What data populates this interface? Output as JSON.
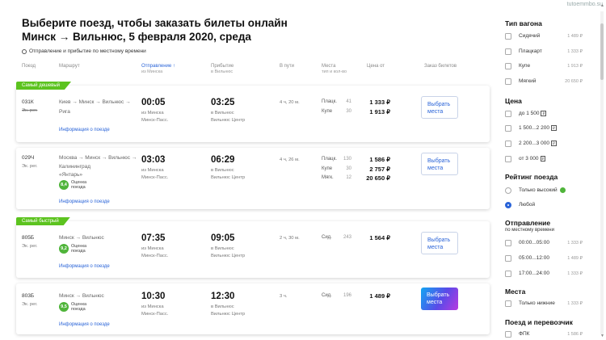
{
  "watermark": "tutoemmbo.su",
  "header": {
    "title": "Выберите поезд, чтобы заказать билеты онлайн",
    "subtitle": "Минск → Вильнюс, 5 февраля 2020, среда",
    "tz_note": "Отправление и прибытие по местному времени"
  },
  "columns": {
    "train": "Поезд",
    "route": "Маршрут",
    "depart": "Отправление ↑",
    "depart_sub": "из Минска",
    "arrive": "Прибытие",
    "arrive_sub": "в Вильнюс",
    "duration": "В пути",
    "seats": "Места",
    "seats_sub": "тип и кол-во",
    "price": "Цена от",
    "order": "Заказ билетов"
  },
  "trains": [
    {
      "tag": "Самый дешевый",
      "number": "031К",
      "class": "Эк. рег.",
      "route": "Киев → Минск → Вильнюс → Рига",
      "route_l1": "Киев → Минск → Вильнюс →",
      "route_l2": "Рига",
      "rating_value": "",
      "rating_label": "",
      "info": "Информация о поезде",
      "dep_time": "00:05",
      "dep_city": "из Минска",
      "dep_station": "Минск-Пасс.",
      "arr_time": "03:25",
      "arr_city": "в Вильнюс",
      "arr_station": "Вильнюс Центр",
      "duration": "4 ч, 20 м.",
      "seat_rows": [
        {
          "cls": "Плацк.",
          "seats": "41",
          "price": "1 333 ₽"
        },
        {
          "cls": "Купе",
          "seats": "30",
          "price": "1 913 ₽"
        }
      ],
      "button": "Выбрать места"
    },
    {
      "tag": "",
      "number": "029Ч",
      "class": "Эк. рег.",
      "route_l1": "Москва → Минск → Вильнюс →",
      "route_l2": "Калининград",
      "route_l3": "«Янтарь»",
      "rating_value": "8,4",
      "rating_label": "Оценка поезда",
      "info": "Информация о поезде",
      "dep_time": "03:03",
      "dep_city": "из Минска",
      "dep_station": "Минск-Пасс.",
      "arr_time": "06:29",
      "arr_city": "в Вильнюс",
      "arr_station": "Вильнюс Центр",
      "duration": "4 ч, 26 м.",
      "seat_rows": [
        {
          "cls": "Плацк.",
          "seats": "130",
          "price": "1 586 ₽"
        },
        {
          "cls": "Купе",
          "seats": "30",
          "price": "2 757 ₽"
        },
        {
          "cls": "Мягк.",
          "seats": "12",
          "price": "20 650 ₽"
        }
      ],
      "button": "Выбрать места"
    },
    {
      "tag": "Самый быстрый",
      "number": "805Б",
      "class": "Эк. рег.",
      "route_l1": "Минск → Вильнюс",
      "rating_value": "9,2",
      "rating_label": "Оценка поезда",
      "info": "Информация о поезде",
      "dep_time": "07:35",
      "dep_city": "из Минска",
      "dep_station": "Минск-Пасс.",
      "arr_time": "09:05",
      "arr_city": "в Вильнюс",
      "arr_station": "Вильнюс Центр",
      "duration": "2 ч, 30 м.",
      "seat_rows": [
        {
          "cls": "Сид.",
          "seats": "243",
          "price": "1 564 ₽"
        }
      ],
      "button": "Выбрать места"
    },
    {
      "tag": "",
      "number": "803Б",
      "class": "Эк. рег.",
      "route_l1": "Минск → Вильнюс",
      "rating_value": "9,5",
      "rating_label": "Оценка поезда",
      "info": "Информация о поезде",
      "dep_time": "10:30",
      "dep_city": "из Минска",
      "dep_station": "Минск-Пасс.",
      "arr_time": "12:30",
      "arr_city": "в Вильнюс",
      "arr_station": "Вильнюс Центр",
      "duration": "3 ч.",
      "seat_rows": [
        {
          "cls": "Сид.",
          "seats": "196",
          "price": "1 489 ₽"
        }
      ],
      "button": "Выбрать места"
    }
  ],
  "filters": {
    "car_type": {
      "title": "Тип вагона",
      "options": [
        {
          "label": "Сидячий",
          "count": "1 489 ₽"
        },
        {
          "label": "Плацкарт",
          "count": "1 333 ₽"
        },
        {
          "label": "Купе",
          "count": "1 913 ₽"
        },
        {
          "label": "Мягкий",
          "count": "20 650 ₽"
        }
      ]
    },
    "price": {
      "title": "Цена",
      "options": [
        {
          "label": "до 1 500"
        },
        {
          "label": "1 500...2 200"
        },
        {
          "label": "2 200...3 000"
        },
        {
          "label": "от 3 000"
        }
      ]
    },
    "rating": {
      "title": "Рейтинг поезда",
      "options": [
        {
          "label": "Только высокий",
          "selected": false
        },
        {
          "label": "Любой",
          "selected": true
        }
      ]
    },
    "departure": {
      "title": "Отправление",
      "subtitle": "по местному времени",
      "options": [
        {
          "label": "00:00...05:00",
          "count": "1 333 ₽"
        },
        {
          "label": "05:00...12:00",
          "count": "1 489 ₽"
        },
        {
          "label": "17:00...24:00",
          "count": "1 333 ₽"
        }
      ]
    },
    "seats": {
      "title": "Места",
      "options": [
        {
          "label": "Только нижние",
          "count": "1 333 ₽"
        }
      ]
    },
    "carrier": {
      "title": "Поезд и перевозчик",
      "options": [
        {
          "label": "ФПК",
          "count": "1 586 ₽"
        }
      ]
    }
  },
  "colors": {
    "accent": "#2a64d8",
    "tag_green": "#5cc31f",
    "rating_green": "#4fb43a"
  }
}
